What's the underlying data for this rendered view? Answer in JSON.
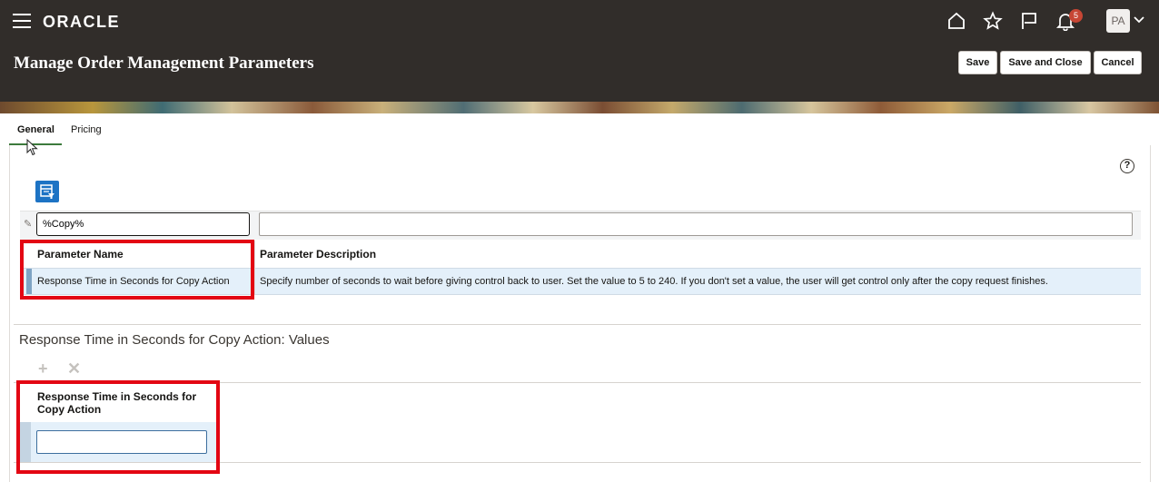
{
  "header": {
    "logo": "ORACLE",
    "notification_count": "5",
    "avatar_initials": "PA",
    "page_title": "Manage Order Management Parameters",
    "buttons": {
      "save": "Save",
      "save_and_close": "Save and Close",
      "cancel": "Cancel"
    },
    "icons": [
      "menu-icon",
      "home-icon",
      "star-icon",
      "flag-icon",
      "bell-icon",
      "chevron-down-icon"
    ]
  },
  "tabs": [
    {
      "label": "General",
      "active": true
    },
    {
      "label": "Pricing",
      "active": false
    }
  ],
  "parameters_table": {
    "filter_name_value": "%Copy%",
    "filter_description_value": "",
    "columns": [
      "Parameter Name",
      "Parameter Description"
    ],
    "rows": [
      {
        "name": "Response Time in Seconds for Copy Action",
        "description": "Specify number of seconds to wait before giving control back to user. Set the value to 5 to 240. If you don't set a value, the user will get control only after the copy request finishes."
      }
    ]
  },
  "values_section": {
    "title": "Response Time in Seconds for Copy Action: Values",
    "column_header": "Response Time in Seconds for Copy Action",
    "value": ""
  },
  "colors": {
    "header_bg": "#312d2a",
    "highlight_red": "#e30613",
    "selected_row": "#e4f0fa",
    "action_blue": "#1d73c4",
    "badge_red": "#c74634"
  }
}
